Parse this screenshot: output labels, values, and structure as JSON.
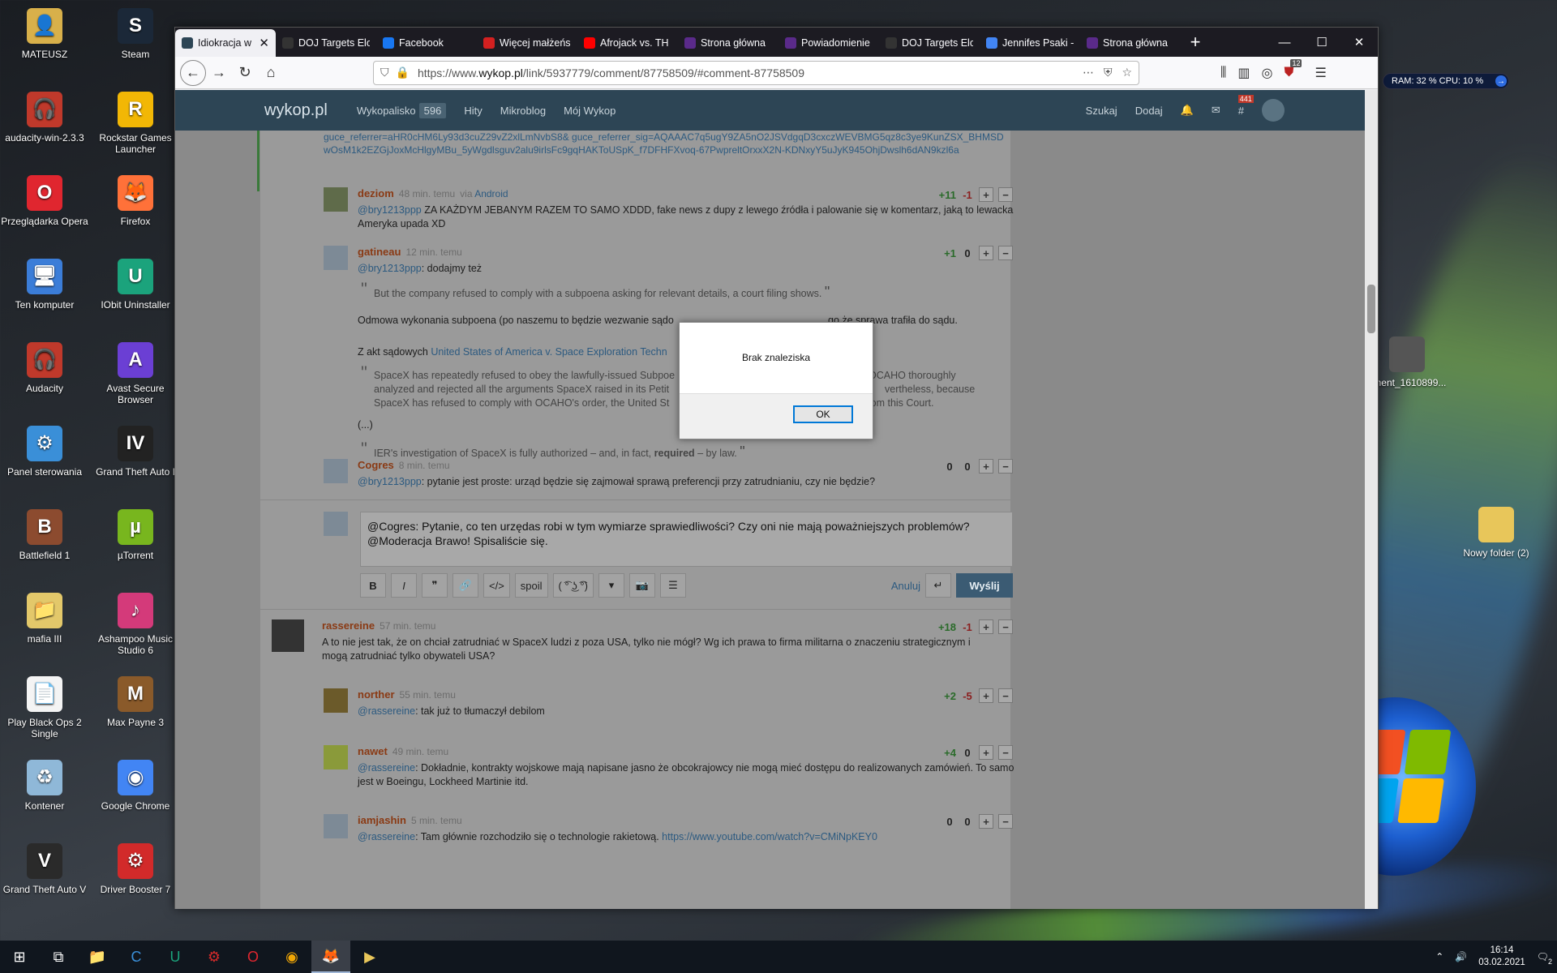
{
  "desktop": {
    "icons_left": [
      {
        "label": "MATEUSZ",
        "icon": "user-folder-icon",
        "color": "#d8b04a",
        "glyph": "👤"
      },
      {
        "label": "audacity-win-2.3.3",
        "icon": "audacity-icon",
        "color": "#c0392b",
        "glyph": "🎧"
      },
      {
        "label": "Przeglądarka Opera",
        "icon": "opera-icon",
        "color": "#e0262f",
        "glyph": "O"
      },
      {
        "label": "Ten komputer",
        "icon": "computer-icon",
        "color": "#3b7dd8",
        "glyph": "🖥"
      },
      {
        "label": "Audacity",
        "icon": "audacity-icon",
        "color": "#c0392b",
        "glyph": "🎧"
      },
      {
        "label": "Panel sterowania",
        "icon": "control-panel-icon",
        "color": "#3a8fd8",
        "glyph": "⚙"
      },
      {
        "label": "Battlefield 1",
        "icon": "battlefield-icon",
        "color": "#8c4b2f",
        "glyph": "B"
      },
      {
        "label": "mafia III",
        "icon": "folder-icon",
        "color": "#e3c86a",
        "glyph": "📁"
      },
      {
        "label": "Play Black Ops 2 Single",
        "icon": "file-icon",
        "color": "#f4f4f4",
        "glyph": "📄"
      },
      {
        "label": "Kontener",
        "icon": "recycle-bin-icon",
        "color": "#8fb8d8",
        "glyph": "♻"
      },
      {
        "label": "Grand Theft Auto V",
        "icon": "gta-v-icon",
        "color": "#2a2a2a",
        "glyph": "V"
      }
    ],
    "icons_right": [
      {
        "label": "Steam",
        "icon": "steam-icon",
        "color": "#1b2838",
        "glyph": "S"
      },
      {
        "label": "Rockstar Games Launcher",
        "icon": "rockstar-icon",
        "color": "#f2b705",
        "glyph": "R"
      },
      {
        "label": "Firefox",
        "icon": "firefox-icon",
        "color": "#ff7139",
        "glyph": "🦊"
      },
      {
        "label": "IObit Uninstaller",
        "icon": "iobit-icon",
        "color": "#1ba37c",
        "glyph": "U"
      },
      {
        "label": "Avast Secure Browser",
        "icon": "avast-icon",
        "color": "#6b3fd4",
        "glyph": "A"
      },
      {
        "label": "Grand Theft Auto I",
        "icon": "gta-iv-icon",
        "color": "#222",
        "glyph": "IV"
      },
      {
        "label": "µTorrent",
        "icon": "utorrent-icon",
        "color": "#78b61e",
        "glyph": "µ"
      },
      {
        "label": "Ashampoo Music Studio 6",
        "icon": "ashampoo-icon",
        "color": "#d43a7a",
        "glyph": "♪"
      },
      {
        "label": "Max Payne 3",
        "icon": "max-payne-icon",
        "color": "#8a5a2a",
        "glyph": "M"
      },
      {
        "label": "Google Chrome",
        "icon": "chrome-icon",
        "color": "#4285f4",
        "glyph": "◉"
      },
      {
        "label": "Driver Booster 7",
        "icon": "driver-booster-icon",
        "color": "#d22a2a",
        "glyph": "⚙"
      }
    ],
    "right_icons": [
      {
        "label": "nment_1610899...",
        "icon": "image-file-icon",
        "color": "#555"
      },
      {
        "label": "Nowy folder (2)",
        "icon": "folder-icon",
        "color": "#e8c65a"
      }
    ]
  },
  "sysmon": {
    "text": "RAM: 32 %  CPU: 10 %"
  },
  "browser": {
    "tabs": [
      {
        "title": "Idiokracja w",
        "color": "#2d4555",
        "active": true
      },
      {
        "title": "DOJ Targets Elo",
        "color": "#333",
        "active": false
      },
      {
        "title": "Facebook",
        "color": "#1877f2",
        "active": false
      },
      {
        "title": "Więcej małżeńs",
        "color": "#d32020",
        "active": false
      },
      {
        "title": "Afrojack vs. TH",
        "color": "#ff0000",
        "active": false
      },
      {
        "title": "Strona główna",
        "color": "#5a2a8a",
        "active": false
      },
      {
        "title": "Powiadomienie",
        "color": "#5a2a8a",
        "active": false
      },
      {
        "title": "DOJ Targets Elo",
        "color": "#333",
        "active": false
      },
      {
        "title": "Jennifes Psaki -",
        "color": "#4285f4",
        "active": false
      },
      {
        "title": "Strona główna",
        "color": "#5a2a8a",
        "active": false
      }
    ],
    "url_prefix": "https://www.",
    "url_domain": "wykop.pl",
    "url_rest": "/link/5937779/comment/87758509/#comment-87758509",
    "extension_badge": "12"
  },
  "site": {
    "logo": "wykop.pl",
    "nav": [
      {
        "label": "Wykopalisko",
        "count": "596"
      },
      {
        "label": "Hity"
      },
      {
        "label": "Mikroblog"
      },
      {
        "label": "Mój Wykop"
      }
    ],
    "right": {
      "search": "Szukaj",
      "add": "Dodaj",
      "tags_badge": "441"
    }
  },
  "refs_text": "guce_referrer=aHR0cHM6Ly93d3cuZ29vZ2xlLmNvbS8& guce_referrer_sig=AQAAAC7q5ugY9ZA5nO2JSVdgqD3cxczWEVBMG5qz8c3ye9KunZSX_BHMSDwOsM1k2EZGjJoxMcHlgyMBu_5yWgdlsguv2alu9irlsFc9gqHAKToUSpK_f7DFHFXvoq-67PwpreltOrxxX2N-KDNxyY5uJyK945OhjDwslh6dAN9kzl6a",
  "comments": [
    {
      "nick": "deziom",
      "time": "48 min. temu",
      "via": "via",
      "via_app": "Android",
      "plus": "+11",
      "minus": "-1",
      "mention": "@bry1213ppp",
      "text": " ZA KAŻDYM JEBANYM RAZEM TO SAMO XDDD, fake news z dupy z lewego źródła i palowanie się w komentarz, jaką to lewacka Ameryka upada XD"
    },
    {
      "nick": "gatineau",
      "time": "12 min. temu",
      "plus": "+1",
      "minus": "0",
      "mention": "@bry1213ppp",
      "text": ": dodajmy też",
      "quote1": "But the company refused to comply with a subpoena asking for relevant details, a court filing shows.",
      "para1": "Odmowa wykonania subpoena (po naszemu to będzie wezwanie sądo",
      "para1_tail": "go że sprawa trafiła do sądu.",
      "para2": "Z akt sądowych ",
      "para2_link": "United States of America v. Space Exploration Techn",
      "quote2": "SpaceX has repeatedly refused to obey the lawfully-issued Subpoe",
      "quote2_tail": "OCAHO thoroughly",
      "quote2_l2": "analyzed and rejected all the arguments SpaceX raised in its Petit",
      "quote2_l2_tail": "vertheless, because",
      "quote2_l3": "SpaceX has refused to comply with OCAHO's order, the United St",
      "quote2_l3_tail": "from this Court.",
      "ellipsis": "(...)",
      "quote3_a": "IER's investigation of SpaceX is fully authorized – and, in fact, ",
      "quote3_b": "required",
      "quote3_c": " – by law."
    },
    {
      "nick": "Cogres",
      "time": "8 min. temu",
      "plus": "0",
      "minus": "0",
      "mention": "@bry1213ppp",
      "text": ": pytanie jest proste: urząd będzie się zajmował sprawą preferencji przy zatrudnianiu, czy nie będzie?"
    }
  ],
  "editor": {
    "line1": "@Cogres: Pytanie, co ten urzędas robi w tym wymiarze sprawiedliwości? Czy oni nie mają poważniejszych problemów?",
    "line2": "@Moderacja Brawo! Spisaliście się.",
    "tools": [
      "B",
      "I",
      "❞",
      "🔗",
      "</>",
      "spoil",
      "( ͡° ͜ʖ ͡°)",
      "▾",
      "📷",
      "☰"
    ],
    "cancel": "Anuluj",
    "send": "Wyślij"
  },
  "thread2": [
    {
      "nick": "rassereine",
      "time": "57 min. temu",
      "plus": "+18",
      "minus": "-1",
      "text": "A to nie jest tak, że on chciał zatrudniać w SpaceX ludzi z poza USA, tylko nie mógł? Wg ich prawa to firma militarna o znaczeniu strategicznym i mogą zatrudniać tylko obywateli USA?"
    },
    {
      "nick": "norther",
      "time": "55 min. temu",
      "plus": "+2",
      "minus": "-5",
      "mention": "@rassereine",
      "text": ": tak już to tłumaczył debilom"
    },
    {
      "nick": "nawet",
      "time": "49 min. temu",
      "plus": "+4",
      "minus": "0",
      "mention": "@rassereine",
      "text": ": Dokładnie, kontrakty wojskowe mają napisane jasno że obcokrajowcy nie mogą mieć dostępu do realizowanych zamówień. To samo jest w Boeingu, Lockheed Martinie itd."
    },
    {
      "nick": "iamjashin",
      "time": "5 min. temu",
      "plus": "0",
      "minus": "0",
      "mention": "@rassereine",
      "text": ": Tam głównie rozchodziło się o technologie rakietową. ",
      "link": "https://www.youtube.com/watch?v=CMiNpKEY0"
    }
  ],
  "dialog": {
    "message": "Brak znaleziska",
    "ok": "OK"
  },
  "taskbar": {
    "time": "16:14",
    "date": "03.02.2021",
    "notif_count": "2"
  }
}
